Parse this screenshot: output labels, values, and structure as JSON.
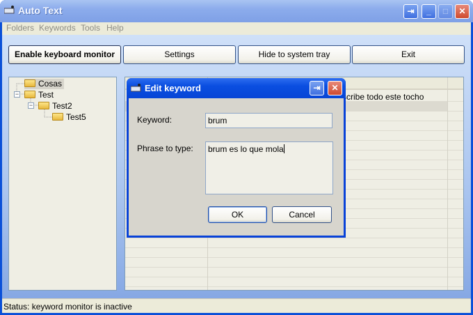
{
  "window": {
    "title": "Auto Text",
    "icon": "keyboard-icon",
    "controls": [
      "restore-to-tray",
      "minimize",
      "maximize",
      "close"
    ]
  },
  "menu": [
    "Folders",
    "Keywords",
    "Tools",
    "Help"
  ],
  "toolbar": {
    "enable": "Enable keyboard monitor",
    "settings": "Settings",
    "hide": "Hide to system tray",
    "exit": "Exit"
  },
  "tree": [
    {
      "label": "Cosas",
      "selected": true
    },
    {
      "label": "Test",
      "expanded": true
    },
    {
      "label": "Test2",
      "expanded": true
    },
    {
      "label": "Test5"
    }
  ],
  "grid": {
    "visible_cell": "scribe todo este tocho"
  },
  "status": "Status: keyword monitor is inactive",
  "dialog": {
    "title": "Edit keyword",
    "keyword_label": "Keyword:",
    "keyword_value": "brum",
    "phrase_label": "Phrase to type:",
    "phrase_value": "brum es lo que mola",
    "ok": "OK",
    "cancel": "Cancel"
  }
}
